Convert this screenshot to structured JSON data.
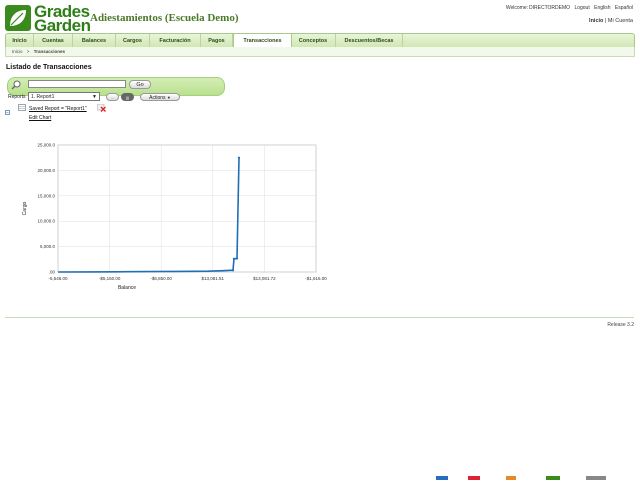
{
  "header": {
    "logo_line1": "Grades",
    "logo_line2": "Garden",
    "app_title": "Adiestamientos (Escuela Demo)",
    "welcome_label": "Welcome:",
    "username": "DIRECTORDEMO",
    "logout": "Logout",
    "lang_english": "English",
    "lang_espanol": "Español",
    "link_inicio": "Inicio",
    "separator": "|",
    "link_mi_cuenta": "Mi Cuenta"
  },
  "nav": {
    "tabs": [
      {
        "label": "Inicio"
      },
      {
        "label": "Cuentas"
      },
      {
        "label": "Balances"
      },
      {
        "label": "Cargos"
      },
      {
        "label": "Facturación"
      },
      {
        "label": "Pagos"
      },
      {
        "label": "Transacciones",
        "active": true
      },
      {
        "label": "Conceptos"
      },
      {
        "label": "Descuentos/Becas"
      }
    ]
  },
  "breadcrumb": {
    "home": "Inicio",
    "sep": ">",
    "current": "Transacciones"
  },
  "page": {
    "title": "Listado de Transacciones"
  },
  "search": {
    "value": "",
    "go_label": "Go",
    "reports_label": "Reports",
    "report_selected": "1. Report1",
    "save_label": "...",
    "reset_label": "|||",
    "actions_label": "Actions"
  },
  "saved_report": {
    "collapse_glyph": "−",
    "link_text": "Saved Report = \"Report1\"",
    "edit_chart": "Edit Chart"
  },
  "chart_data": {
    "type": "line",
    "xlabel": "Balance",
    "ylabel": "Cargo",
    "x_ticks": [
      "-5,548.00",
      "-$5,150.00",
      "-$6,850.00",
      "$13,081.51",
      "$13,081.72",
      "-$1,616.00"
    ],
    "y_ticks": [
      ".00",
      "5,000.0",
      "10,000.0",
      "15,000.0",
      "20,000.0",
      "25,000.0"
    ],
    "ylim": [
      0,
      25000
    ],
    "grid": true,
    "series": [
      {
        "color": "#1f6fb5",
        "points": [
          [
            0,
            0
          ],
          [
            30,
            20
          ],
          [
            60,
            40
          ],
          [
            90,
            80
          ],
          [
            120,
            120
          ],
          [
            150,
            160
          ],
          [
            165,
            250
          ],
          [
            175,
            350
          ],
          [
            176,
            2600
          ],
          [
            179,
            2650
          ],
          [
            181,
            22500
          ]
        ]
      }
    ]
  },
  "footer": {
    "release": "Release 3.2"
  },
  "colors": {
    "brand_green": "#2f7f18",
    "nav_bg": "#cfe7b1",
    "series_blue": "#1f6fb5"
  }
}
